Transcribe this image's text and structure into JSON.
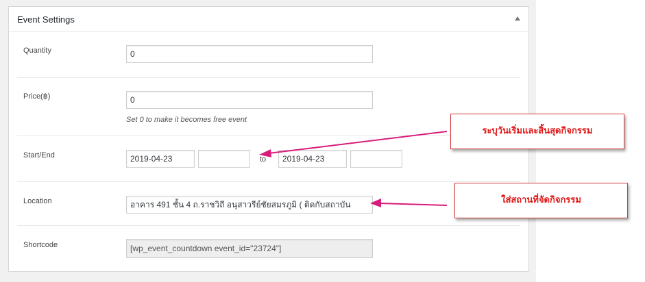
{
  "panel": {
    "title": "Event Settings",
    "toggle_icon": "triangle-up-icon"
  },
  "fields": {
    "quantity": {
      "label": "Quantity",
      "value": "0"
    },
    "price": {
      "label": "Price(฿)",
      "value": "0",
      "hint": "Set 0 to make it becomes free event"
    },
    "start_end": {
      "label": "Start/End",
      "start_date": "2019-04-23",
      "start_time": "",
      "to_label": "to",
      "end_date": "2019-04-23",
      "end_time": ""
    },
    "location": {
      "label": "Location",
      "value": "อาคาร 491 ชั้น 4 ถ.ราชวิถี อนุสาวรีย์ชัยสมรภูมิ ( ติดกับสถาบัน"
    },
    "shortcode": {
      "label": "Shortcode",
      "value": "[wp_event_countdown event_id=\"23724\"]"
    }
  },
  "annotations": {
    "date_callout": "ระบุวันเริ่มและสิ้นสุดกิจกรรม",
    "location_callout": "ใส่สถานที่จัดกิจกรรม",
    "color": "#d81b7a"
  }
}
